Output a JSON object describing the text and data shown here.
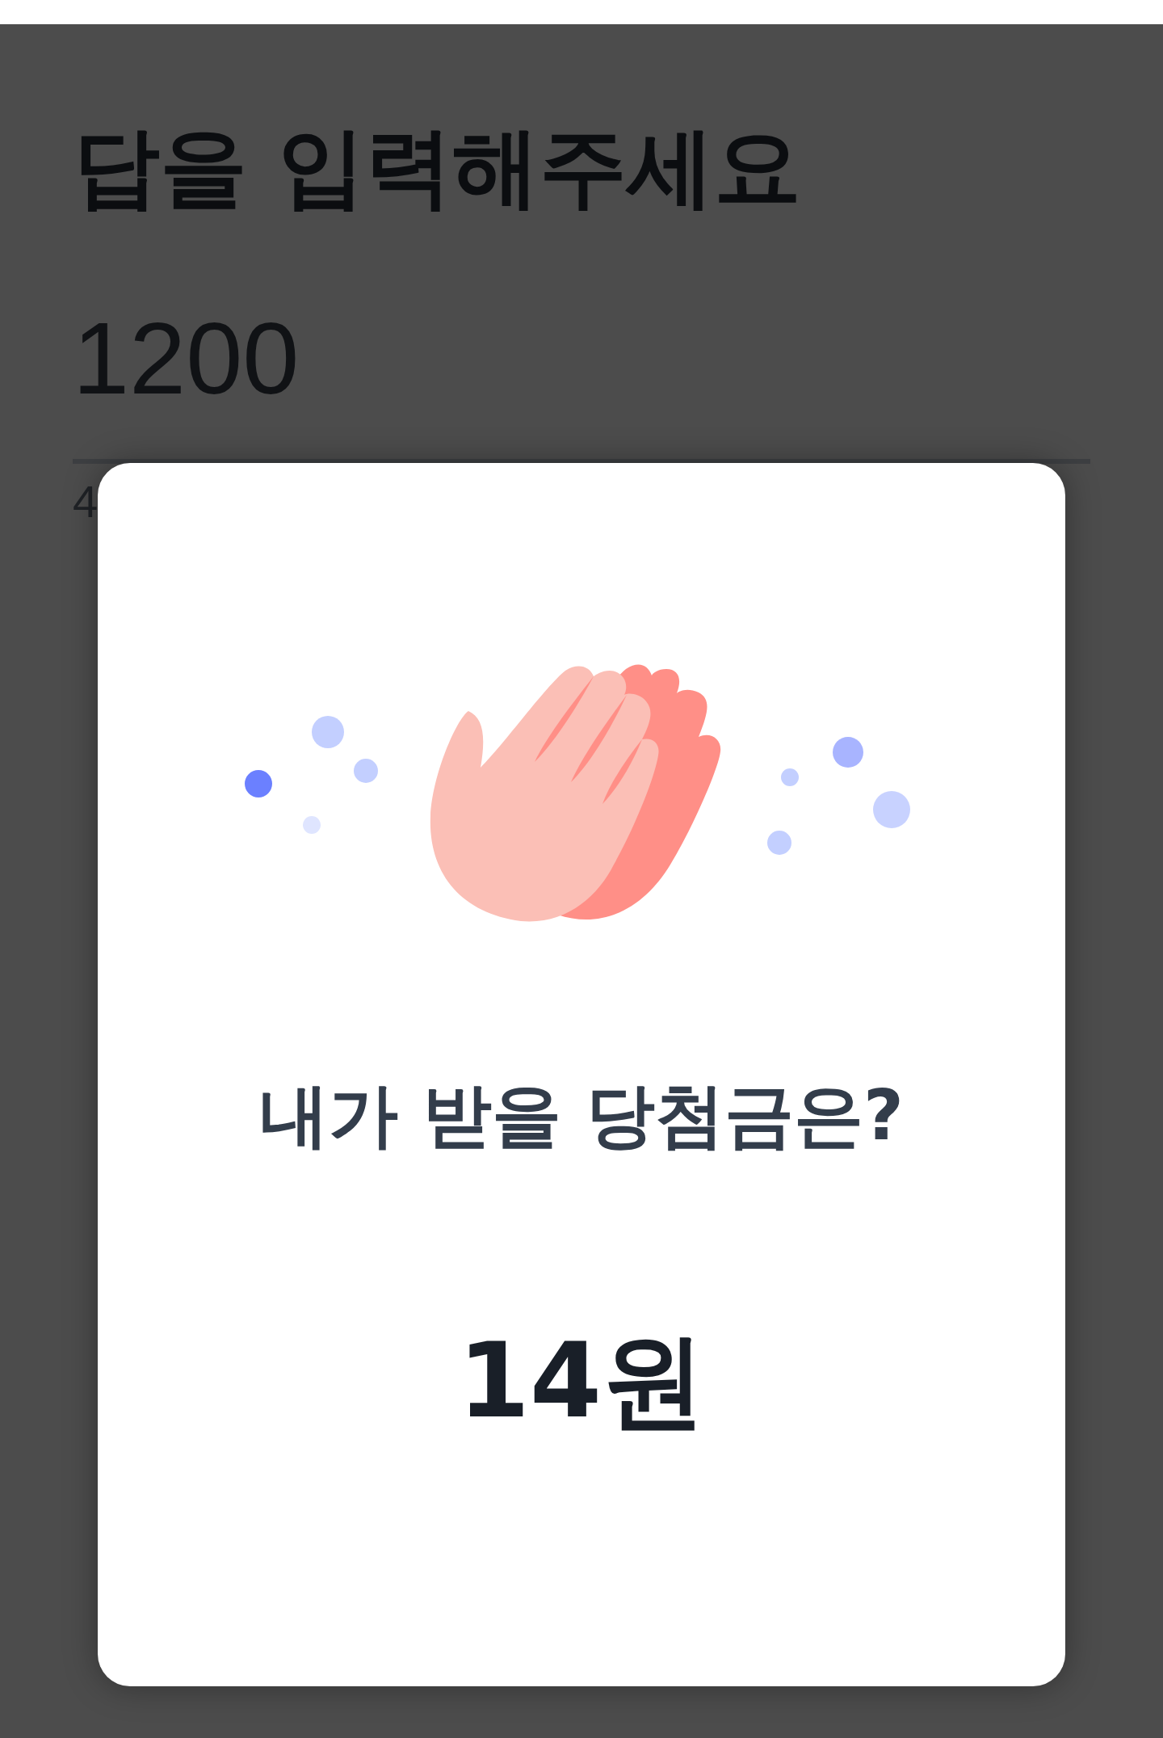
{
  "header": {
    "title": "답을 입력해주세요"
  },
  "answer_field": {
    "value": "1200",
    "helper": "4"
  },
  "result_dialog": {
    "question": "내가 받을 당첨금은?",
    "amount": "14원"
  }
}
